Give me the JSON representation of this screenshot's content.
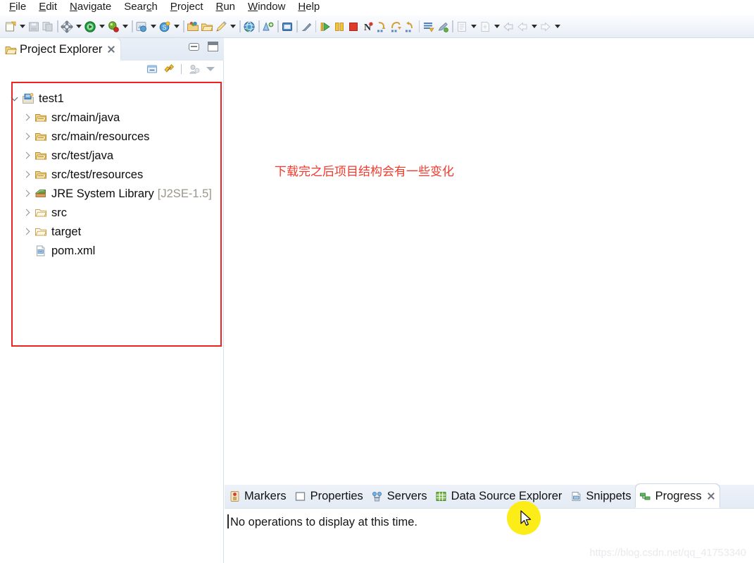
{
  "menubar": {
    "items": [
      {
        "label": "File",
        "mnemonic": "F"
      },
      {
        "label": "Edit",
        "mnemonic": "E"
      },
      {
        "label": "Navigate",
        "mnemonic": "N"
      },
      {
        "label": "Search",
        "mnemonic": "c"
      },
      {
        "label": "Project",
        "mnemonic": "P"
      },
      {
        "label": "Run",
        "mnemonic": "R"
      },
      {
        "label": "Window",
        "mnemonic": "W"
      },
      {
        "label": "Help",
        "mnemonic": "H"
      }
    ]
  },
  "toolbar": {
    "items": [
      {
        "name": "new-wizard-icon",
        "type": "icon"
      },
      {
        "name": "new-wizard-dropdown",
        "type": "arrow"
      },
      {
        "name": "save-icon",
        "type": "icon"
      },
      {
        "name": "save-all-icon",
        "type": "icon"
      },
      {
        "name": "separator",
        "type": "sep"
      },
      {
        "name": "build-all-icon",
        "type": "icon"
      },
      {
        "name": "build-dropdown",
        "type": "arrow"
      },
      {
        "name": "run-icon",
        "type": "icon"
      },
      {
        "name": "run-dropdown",
        "type": "arrow"
      },
      {
        "name": "debug-icon",
        "type": "icon"
      },
      {
        "name": "debug-dropdown",
        "type": "arrow"
      },
      {
        "name": "separator",
        "type": "sep"
      },
      {
        "name": "external-tools-icon",
        "type": "icon"
      },
      {
        "name": "external-tools-dropdown",
        "type": "arrow"
      },
      {
        "name": "run-server-icon",
        "type": "icon"
      },
      {
        "name": "run-server-dropdown",
        "type": "arrow"
      },
      {
        "name": "separator",
        "type": "sep"
      },
      {
        "name": "new-java-package-icon",
        "type": "icon"
      },
      {
        "name": "new-java-class-icon",
        "type": "icon"
      },
      {
        "name": "new-annotation-icon",
        "type": "icon"
      },
      {
        "name": "new-element-dropdown",
        "type": "arrow"
      },
      {
        "name": "separator",
        "type": "sep"
      },
      {
        "name": "open-web-browser-icon",
        "type": "icon"
      },
      {
        "name": "separator",
        "type": "sep"
      },
      {
        "name": "open-type-icon",
        "type": "icon"
      },
      {
        "name": "separator",
        "type": "sep"
      },
      {
        "name": "open-task-icon",
        "type": "icon"
      },
      {
        "name": "separator",
        "type": "sep"
      },
      {
        "name": "toggle-mark-occurrences-icon",
        "type": "icon"
      },
      {
        "name": "separator-solid",
        "type": "sep-solid"
      },
      {
        "name": "resume-icon",
        "type": "icon"
      },
      {
        "name": "suspend-icon",
        "type": "icon"
      },
      {
        "name": "terminate-icon",
        "type": "icon"
      },
      {
        "name": "disconnect-icon",
        "type": "icon"
      },
      {
        "name": "step-into-icon",
        "type": "icon"
      },
      {
        "name": "step-over-icon",
        "type": "icon"
      },
      {
        "name": "step-return-icon",
        "type": "icon"
      },
      {
        "name": "separator-solid",
        "type": "sep-solid"
      },
      {
        "name": "next-annotation-icon",
        "type": "icon"
      },
      {
        "name": "previous-annotation-icon",
        "type": "icon"
      },
      {
        "name": "separator",
        "type": "sep"
      },
      {
        "name": "last-edit-location-icon",
        "type": "icon"
      },
      {
        "name": "last-edit-dropdown",
        "type": "arrow"
      },
      {
        "name": "previous-edit-icon",
        "type": "icon"
      },
      {
        "name": "previous-edit-dropdown",
        "type": "arrow"
      },
      {
        "name": "back-history-icon",
        "type": "icon"
      },
      {
        "name": "back-navigate-icon",
        "type": "icon"
      },
      {
        "name": "back-dropdown",
        "type": "arrow"
      },
      {
        "name": "forward-navigate-icon",
        "type": "icon"
      },
      {
        "name": "forward-dropdown",
        "type": "arrow"
      }
    ]
  },
  "project_explorer": {
    "tab_title": "Project Explorer",
    "view_tools": [
      "collapse-all-icon",
      "link-with-editor-icon",
      "focus-on-active-task-icon",
      "view-menu-icon"
    ],
    "window_buttons": [
      "minimize-button",
      "maximize-button"
    ],
    "tree": [
      {
        "label": "test1",
        "suffix": "",
        "icon": "java-project-icon",
        "twisty": "down",
        "indent": 0
      },
      {
        "label": "src/main/java",
        "suffix": "",
        "icon": "source-folder-icon",
        "twisty": "right",
        "indent": 1
      },
      {
        "label": "src/main/resources",
        "suffix": "",
        "icon": "source-folder-icon",
        "twisty": "right",
        "indent": 1
      },
      {
        "label": "src/test/java",
        "suffix": "",
        "icon": "source-folder-icon",
        "twisty": "right",
        "indent": 1
      },
      {
        "label": "src/test/resources",
        "suffix": "",
        "icon": "source-folder-icon",
        "twisty": "right",
        "indent": 1
      },
      {
        "label": "JRE System Library",
        "suffix": "[J2SE-1.5]",
        "icon": "jre-library-icon",
        "twisty": "right",
        "indent": 1
      },
      {
        "label": "src",
        "suffix": "",
        "icon": "folder-icon",
        "twisty": "right",
        "indent": 1
      },
      {
        "label": "target",
        "suffix": "",
        "icon": "folder-icon",
        "twisty": "right",
        "indent": 1
      },
      {
        "label": "pom.xml",
        "suffix": "",
        "icon": "xml-file-icon",
        "twisty": "none",
        "indent": 1
      }
    ]
  },
  "editor": {
    "annotation_text": "下载完之后项目结构会有一些变化"
  },
  "bottom_panel": {
    "tabs": [
      {
        "label": "Markers",
        "icon": "markers-icon",
        "active": false,
        "closable": false
      },
      {
        "label": "Properties",
        "icon": "properties-icon",
        "active": false,
        "closable": false
      },
      {
        "label": "Servers",
        "icon": "servers-icon",
        "active": false,
        "closable": false
      },
      {
        "label": "Data Source Explorer",
        "icon": "data-source-explorer-icon",
        "active": false,
        "closable": false
      },
      {
        "label": "Snippets",
        "icon": "snippets-icon",
        "active": false,
        "closable": false
      },
      {
        "label": "Progress",
        "icon": "progress-icon",
        "active": true,
        "closable": true
      }
    ],
    "message": "No operations to display at this time."
  },
  "watermark": {
    "text": "https://blog.csdn.net/qq_41753340"
  },
  "colors": {
    "annotation_red": "#ee2222",
    "note_red": "#f4392c",
    "cursor_highlight": "#fcec18",
    "toolbar_bg": "#eef2f8"
  }
}
